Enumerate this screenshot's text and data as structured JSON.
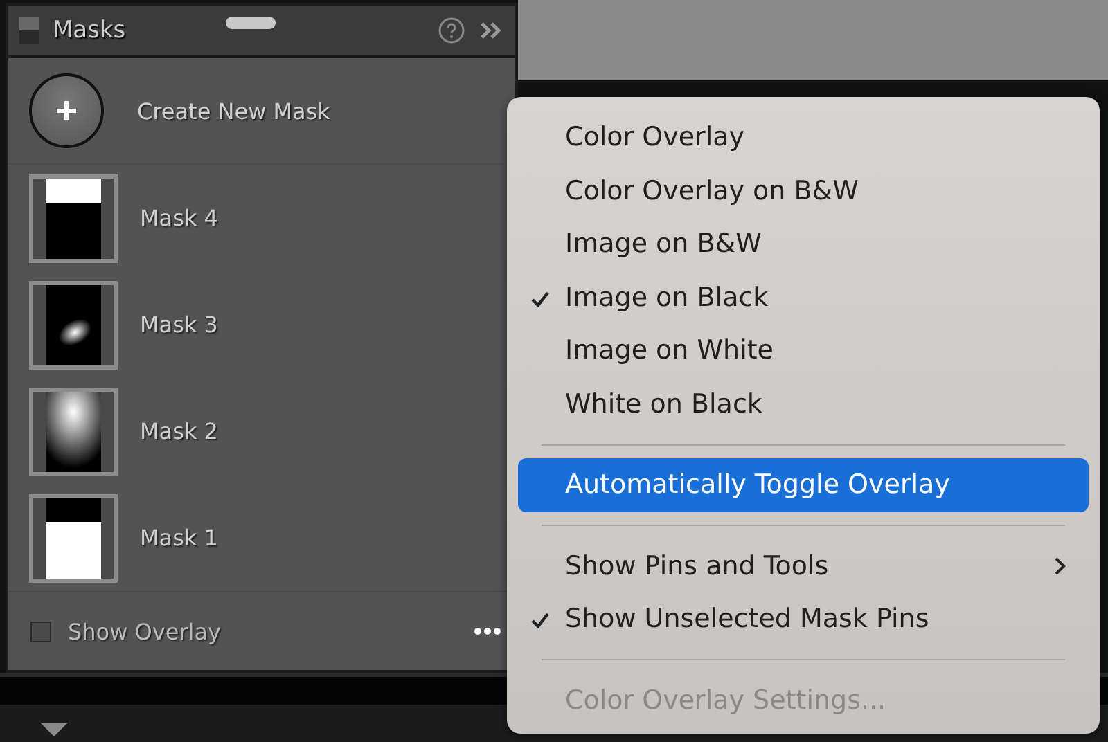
{
  "panel": {
    "title": "Masks",
    "create_label": "Create New Mask",
    "masks": [
      {
        "name": "Mask 4",
        "kind": "top-white"
      },
      {
        "name": "Mask 3",
        "kind": "radial"
      },
      {
        "name": "Mask 2",
        "kind": "vertical-glow"
      },
      {
        "name": "Mask 1",
        "kind": "bottom-white"
      }
    ],
    "show_overlay": {
      "label": "Show Overlay",
      "checked": false
    }
  },
  "menu": {
    "items": [
      {
        "kind": "item",
        "label": "Color Overlay",
        "checked": false,
        "selected": false,
        "disabled": false
      },
      {
        "kind": "item",
        "label": "Color Overlay on B&W",
        "checked": false,
        "selected": false,
        "disabled": false
      },
      {
        "kind": "item",
        "label": "Image on B&W",
        "checked": false,
        "selected": false,
        "disabled": false
      },
      {
        "kind": "item",
        "label": "Image on Black",
        "checked": true,
        "selected": false,
        "disabled": false
      },
      {
        "kind": "item",
        "label": "Image on White",
        "checked": false,
        "selected": false,
        "disabled": false
      },
      {
        "kind": "item",
        "label": "White on Black",
        "checked": false,
        "selected": false,
        "disabled": false
      },
      {
        "kind": "separator"
      },
      {
        "kind": "item",
        "label": "Automatically Toggle Overlay",
        "checked": false,
        "selected": true,
        "disabled": false
      },
      {
        "kind": "separator"
      },
      {
        "kind": "submenu",
        "label": "Show Pins and Tools",
        "checked": false,
        "selected": false,
        "disabled": false
      },
      {
        "kind": "item",
        "label": "Show Unselected Mask Pins",
        "checked": true,
        "selected": false,
        "disabled": false
      },
      {
        "kind": "separator"
      },
      {
        "kind": "item",
        "label": "Color Overlay Settings...",
        "checked": false,
        "selected": false,
        "disabled": true
      }
    ]
  }
}
